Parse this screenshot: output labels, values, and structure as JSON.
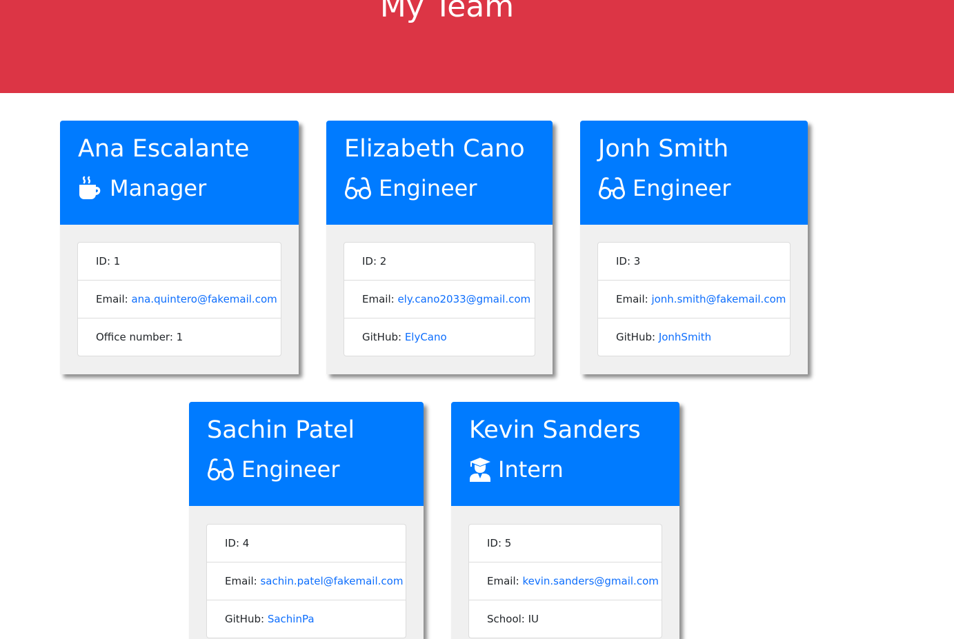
{
  "header": {
    "title": "My Team"
  },
  "team": [
    {
      "name": "Ana Escalante",
      "role": "Manager",
      "icon": "mug-hot-icon",
      "id_label": "ID: ",
      "id": "1",
      "email_label": "Email: ",
      "email": "ana.quintero@fakemail.com",
      "extra_label": "Office number: ",
      "extra": "1"
    },
    {
      "name": "Elizabeth Cano",
      "role": "Engineer",
      "icon": "glasses-icon",
      "id_label": "ID: ",
      "id": "2",
      "email_label": "Email: ",
      "email": "ely.cano2033@gmail.com",
      "extra_label": "GitHub: ",
      "extra": "ElyCano"
    },
    {
      "name": "Jonh Smith",
      "role": "Engineer",
      "icon": "glasses-icon",
      "id_label": "ID: ",
      "id": "3",
      "email_label": "Email: ",
      "email": "jonh.smith@fakemail.com",
      "extra_label": "GitHub: ",
      "extra": "JonhSmith"
    },
    {
      "name": "Sachin Patel",
      "role": "Engineer",
      "icon": "glasses-icon",
      "id_label": "ID: ",
      "id": "4",
      "email_label": "Email: ",
      "email": "sachin.patel@fakemail.com",
      "extra_label": "GitHub: ",
      "extra": "SachinPa"
    },
    {
      "name": "Kevin Sanders",
      "role": "Intern",
      "icon": "graduate-icon",
      "id_label": "ID: ",
      "id": "5",
      "email_label": "Email: ",
      "email": "kevin.sanders@gmail.com",
      "extra_label": "School: ",
      "extra": "IU"
    }
  ],
  "colors": {
    "header_bg": "#dc3545",
    "card_head_bg": "#007bff",
    "link": "#0d6efd"
  }
}
